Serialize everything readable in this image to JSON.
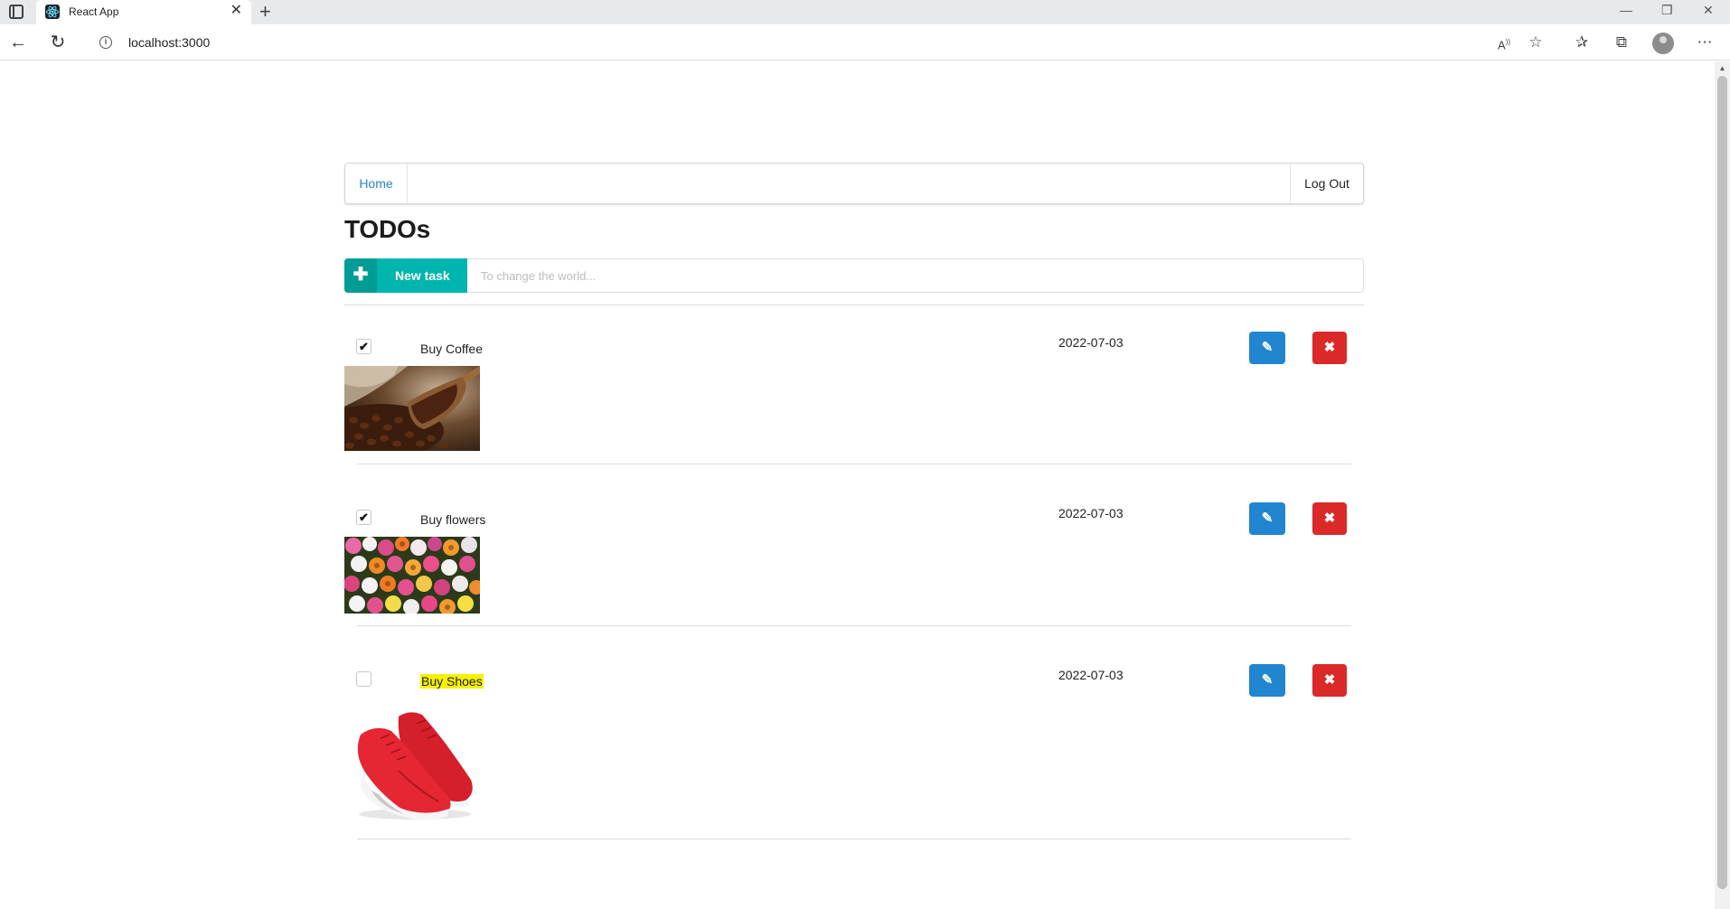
{
  "browser": {
    "tab_title": "React App",
    "url": "localhost:3000",
    "icons": [
      "window-icon",
      "react-favicon",
      "close-icon",
      "new-tab-icon",
      "back-icon",
      "refresh-icon",
      "info-icon",
      "read-aloud-icon",
      "add-favorite-icon",
      "favorites-icon",
      "collections-icon",
      "profile-icon",
      "more-icon",
      "minimize-icon",
      "restore-icon",
      "window-close-icon"
    ]
  },
  "menu": {
    "home_label": "Home",
    "logout_label": "Log Out"
  },
  "page": {
    "title": "TODOs"
  },
  "new_task": {
    "button_label": "New task",
    "placeholder": "To change the world...",
    "icon": "plus-icon"
  },
  "todos": [
    {
      "label": "Buy Coffee",
      "date": "2022-07-03",
      "checked": true,
      "highlighted": false,
      "image": "coffee-beans-image"
    },
    {
      "label": "Buy flowers",
      "date": "2022-07-03",
      "checked": true,
      "highlighted": false,
      "image": "flowers-image"
    },
    {
      "label": "Buy Shoes",
      "date": "2022-07-03",
      "checked": false,
      "highlighted": true,
      "image": "red-shoes-image"
    }
  ],
  "colors": {
    "teal": "#00b5ad",
    "blue": "#2185d0",
    "red": "#db2828",
    "highlight": "#f7f100"
  }
}
